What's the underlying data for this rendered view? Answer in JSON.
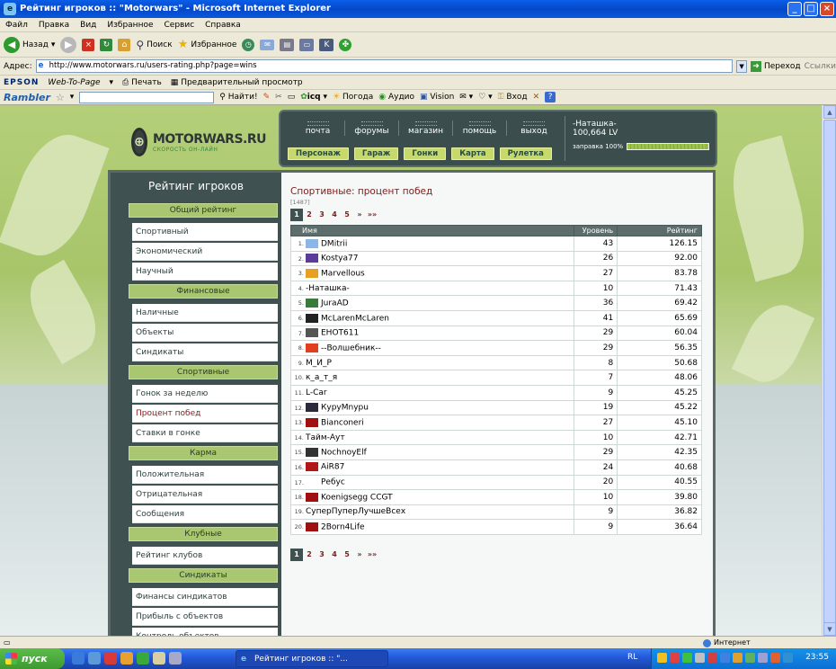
{
  "window": {
    "title": "Рейтинг игроков :: \"Motorwars\" - Microsoft Internet Explorer"
  },
  "menu": [
    "Файл",
    "Правка",
    "Вид",
    "Избранное",
    "Сервис",
    "Справка"
  ],
  "toolbar": {
    "back": "Назад",
    "search": "Поиск",
    "favorites": "Избранное"
  },
  "address": {
    "label": "Адрес:",
    "url": "http://www.motorwars.ru/users-rating.php?page=wins",
    "go": "Переход",
    "links": "Ссылки"
  },
  "epson": {
    "brand": "EPSON",
    "web_to_page": "Web-To-Page",
    "print": "Печать",
    "preview": "Предварительный просмотр"
  },
  "rambler": {
    "brand": "Rambler",
    "find": "Найти!",
    "icq": "icq",
    "weather": "Погода",
    "audio": "Аудио",
    "vision": "Vision",
    "login": "Вход"
  },
  "site": {
    "logo": "MOTORWARS.RU",
    "slogan": "СКОРОСТЬ ОН-ЛАЙН",
    "nav_top": [
      "почта",
      "форумы",
      "магазин",
      "помощь",
      "выход"
    ],
    "nav_bottom": [
      "Персонаж",
      "Гараж",
      "Гонки",
      "Карта",
      "Рулетка"
    ],
    "user": {
      "name": "-Наташка-",
      "level": "100,664 LV",
      "fuel_label": "заправка 100%",
      "fuel_fraction": 1.0
    }
  },
  "sidebar": {
    "title": "Рейтинг игроков",
    "groups": [
      {
        "label": "Общий рейтинг",
        "items": [
          "Спортивный",
          "Экономический",
          "Научный"
        ]
      },
      {
        "label": "Финансовые",
        "items": [
          "Наличные",
          "Объекты",
          "Синдикаты"
        ]
      },
      {
        "label": "Спортивные",
        "items": [
          "Гонок за неделю",
          "Процент побед",
          "Ставки в гонке"
        ]
      },
      {
        "label": "Карма",
        "items": [
          "Положительная",
          "Отрицательная",
          "Сообщения"
        ]
      },
      {
        "label": "Клубные",
        "items": [
          "Рейтинг клубов"
        ]
      },
      {
        "label": "Синдикаты",
        "items": [
          "Финансы синдикатов",
          "Прибыль с объектов",
          "Контроль объектов"
        ]
      }
    ],
    "active": "Процент побед"
  },
  "rating": {
    "title": "Спортивные: процент побед",
    "count": "[1487]",
    "pages": [
      "1",
      "2",
      "3",
      "4",
      "5",
      "»",
      "»»"
    ],
    "columns": [
      "Имя",
      "Уровень",
      "Рейтинг"
    ],
    "rows": [
      {
        "rank": "1.",
        "name": "DMitrii",
        "level": "43",
        "rating": "126.15",
        "color": "#8ab6e8"
      },
      {
        "rank": "2.",
        "name": "Kostya77",
        "level": "26",
        "rating": "92.00",
        "color": "#5a3c9a"
      },
      {
        "rank": "3.",
        "name": "Marvellous",
        "level": "27",
        "rating": "83.78",
        "color": "#e8a020"
      },
      {
        "rank": "4.",
        "name": "-Наташка-",
        "level": "10",
        "rating": "71.43",
        "color": ""
      },
      {
        "rank": "5.",
        "name": "JuraAD",
        "level": "36",
        "rating": "69.42",
        "color": "#3a7a3a"
      },
      {
        "rank": "6.",
        "name": "McLarenMcLaren",
        "level": "41",
        "rating": "65.69",
        "color": "#222222"
      },
      {
        "rank": "7.",
        "name": "EHOT611",
        "level": "29",
        "rating": "60.04",
        "color": "#555555"
      },
      {
        "rank": "8.",
        "name": "--Волшебник--",
        "level": "29",
        "rating": "56.35",
        "color": "#e04020"
      },
      {
        "rank": "9.",
        "name": "М_И_Р",
        "level": "8",
        "rating": "50.68",
        "color": ""
      },
      {
        "rank": "10.",
        "name": "к_а_т_я",
        "level": "7",
        "rating": "48.06",
        "color": ""
      },
      {
        "rank": "11.",
        "name": "L-Car",
        "level": "9",
        "rating": "45.25",
        "color": ""
      },
      {
        "rank": "12.",
        "name": "КуpyMnypu",
        "level": "19",
        "rating": "45.22",
        "color": "#2a2a3a"
      },
      {
        "rank": "13.",
        "name": "Bianconeri",
        "level": "27",
        "rating": "45.10",
        "color": "#a01010"
      },
      {
        "rank": "14.",
        "name": "Тайм-Аут",
        "level": "10",
        "rating": "42.71",
        "color": ""
      },
      {
        "rank": "15.",
        "name": "NochnoyElf",
        "level": "29",
        "rating": "42.35",
        "color": "#333333"
      },
      {
        "rank": "16.",
        "name": "AiR87",
        "level": "24",
        "rating": "40.68",
        "color": "#b01818"
      },
      {
        "rank": "17.",
        "name": "Ребус",
        "level": "20",
        "rating": "40.55",
        "color": "#ffffff"
      },
      {
        "rank": "18.",
        "name": "Koenigsegg CCGT",
        "level": "10",
        "rating": "39.80",
        "color": "#a01010"
      },
      {
        "rank": "19.",
        "name": "СуперПуперЛучшеВсех",
        "level": "9",
        "rating": "36.82",
        "color": ""
      },
      {
        "rank": "20.",
        "name": "2Born4Life",
        "level": "9",
        "rating": "36.64",
        "color": "#a01010"
      }
    ]
  },
  "status": {
    "zone": "Интернет"
  },
  "taskbar": {
    "start": "пуск",
    "task": "Рейтинг игроков :: \"...",
    "lang": "RL",
    "clock": "23:55"
  }
}
